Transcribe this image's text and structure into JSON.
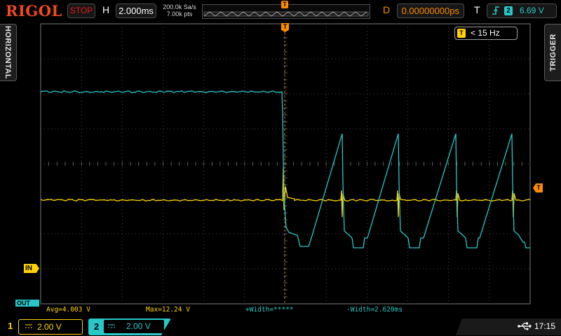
{
  "brand": "RIGOL",
  "top": {
    "run_state": "STOP",
    "h_label": "H",
    "timebase": "2.000ms",
    "sample_rate": "200.0k Sa/s",
    "memory_depth": "7.00k pts",
    "d_label": "D",
    "delay": "0.00000000ps",
    "t_label": "T",
    "trigger_source": "2",
    "trigger_level": "6.69 V",
    "trigger_marker": "T"
  },
  "side_tabs": {
    "left": "HORIZONTAL",
    "right": "TRIGGER"
  },
  "freq_counter": {
    "badge": "T",
    "value": "< 15 Hz"
  },
  "markers": {
    "ch1_ground": "IN",
    "ch2_ground": "OUT",
    "trigger_level": "T",
    "trigger_position": "T"
  },
  "measurements": {
    "avg": "Avg=4.003 V",
    "max": "Max=12.24 V",
    "pwidth": "+Width=*****",
    "nwidth": "-Width=2.620ms"
  },
  "channels": [
    {
      "num": "1",
      "scale": "2.00 V"
    },
    {
      "num": "2",
      "scale": "2.00 V"
    }
  ],
  "clock": "17:15",
  "colors": {
    "ch1": "#ffd400",
    "ch2": "#28c8c8",
    "trigger": "#ff8c00",
    "brand": "#f04a1e",
    "stop": "#e51b1b"
  },
  "icons": {
    "coupling": "dc-coupling-icon",
    "trigger_edge": "rising-edge-icon",
    "usb": "usb-icon"
  }
}
